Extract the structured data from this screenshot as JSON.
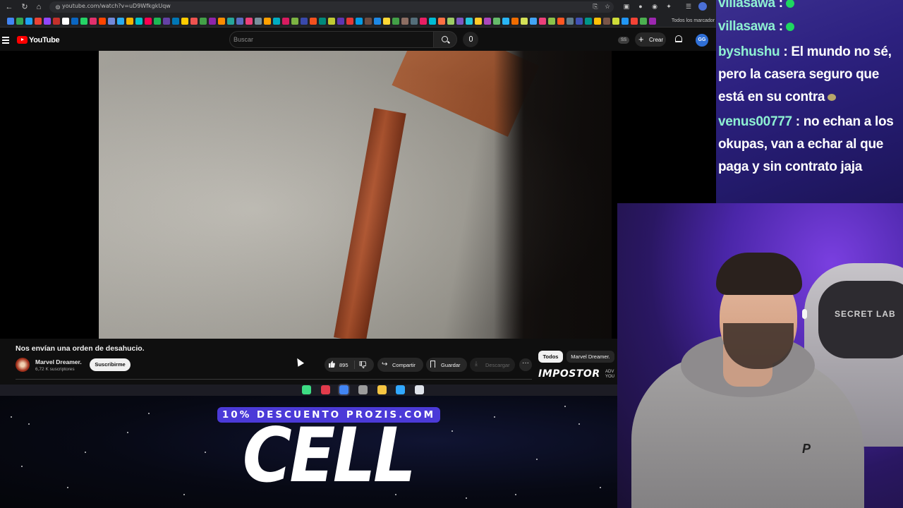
{
  "browser": {
    "url": "youtube.com/watch?v=uD9WfkgkUqw",
    "bookmarks_all_label": "Todos los marcador",
    "bookmark_colors": [
      "#4285f4",
      "#34a853",
      "#1da1f2",
      "#ea4335",
      "#9146ff",
      "#c4302b",
      "#ffffff",
      "#0a66c2",
      "#25d366",
      "#e1306c",
      "#ff4500",
      "#7289da",
      "#2aabee",
      "#f4b400",
      "#00c4cc",
      "#ff0050",
      "#1db954",
      "#6441a5",
      "#0077b5",
      "#ffcc00",
      "#ef5350",
      "#43a047",
      "#8e24aa",
      "#fb8c00",
      "#26a69a",
      "#5c6bc0",
      "#ec407a",
      "#78909c",
      "#ffa000",
      "#00acc1",
      "#d81b60",
      "#7cb342",
      "#3949ab",
      "#f4511e",
      "#00897b",
      "#c0ca33",
      "#5e35b1",
      "#e53935",
      "#039be5",
      "#6d4c41",
      "#1e88e5",
      "#fdd835",
      "#43a047",
      "#8d6e63",
      "#546e7a",
      "#e91e63",
      "#00bcd4",
      "#ff7043",
      "#9ccc65",
      "#7e57c2",
      "#26c6da",
      "#ffca28",
      "#ab47bc",
      "#66bb6a",
      "#29b6f6",
      "#ef6c00",
      "#d4e157",
      "#42a5f5",
      "#ec407a",
      "#8bc34a",
      "#ff5722",
      "#607d8b",
      "#3f51b5",
      "#009688",
      "#ffc107",
      "#795548",
      "#cddc39",
      "#2196f3",
      "#f44336",
      "#4caf50",
      "#9c27b0",
      "#ff9800",
      "#00bcd4"
    ]
  },
  "youtube": {
    "logo_text": "YouTube",
    "search_placeholder": "Buscar",
    "cast_badge": "SS",
    "create_label": "Crear",
    "avatar_text": "GG"
  },
  "video": {
    "title": "Nos envían una orden de desahucio.",
    "channel_name": "Marvel Dreamer.",
    "channel_subs": "6,72 K suscriptores",
    "subscribe_label": "Suscribirme",
    "like_count": "895",
    "share_label": "Compartir",
    "save_label": "Guardar",
    "download_label": "Descargar",
    "more_label": "···"
  },
  "recommendations": {
    "chip_all": "Todos",
    "chip_channel": "Marvel Dreamer.",
    "thumb_title": "IMPOSTOR",
    "thumb_side": "ADV\nYOU"
  },
  "taskbar": {
    "icons": [
      {
        "name": "android-icon",
        "color": "#3ddc84"
      },
      {
        "name": "opera-gx-icon",
        "color": "#e13b4c"
      },
      {
        "name": "chrome-icon",
        "color": "#4285f4"
      },
      {
        "name": "obs-icon",
        "color": "#9c9c9c"
      },
      {
        "name": "file-explorer-icon",
        "color": "#f5c542"
      },
      {
        "name": "photoshop-icon",
        "color": "#31a8ff"
      },
      {
        "name": "app-icon",
        "color": "#dfe3ea"
      }
    ]
  },
  "promo": {
    "banner": "10% DESCUENTO PROZIS.COM",
    "brand": "CELL"
  },
  "chat": {
    "messages": [
      {
        "user": "villasawa",
        "text": ""
      },
      {
        "user": "villasawa",
        "text": ""
      },
      {
        "user": "byshushu",
        "text": "El mundo no sé, pero la casera seguro que está en su contra"
      },
      {
        "user": "venus00777",
        "text": "no echan a los okupas, van a echar al que paga y sin contrato jaja"
      }
    ]
  },
  "webcam": {
    "chair_logo": "SECRET LAB",
    "shirt_logo": "P"
  }
}
